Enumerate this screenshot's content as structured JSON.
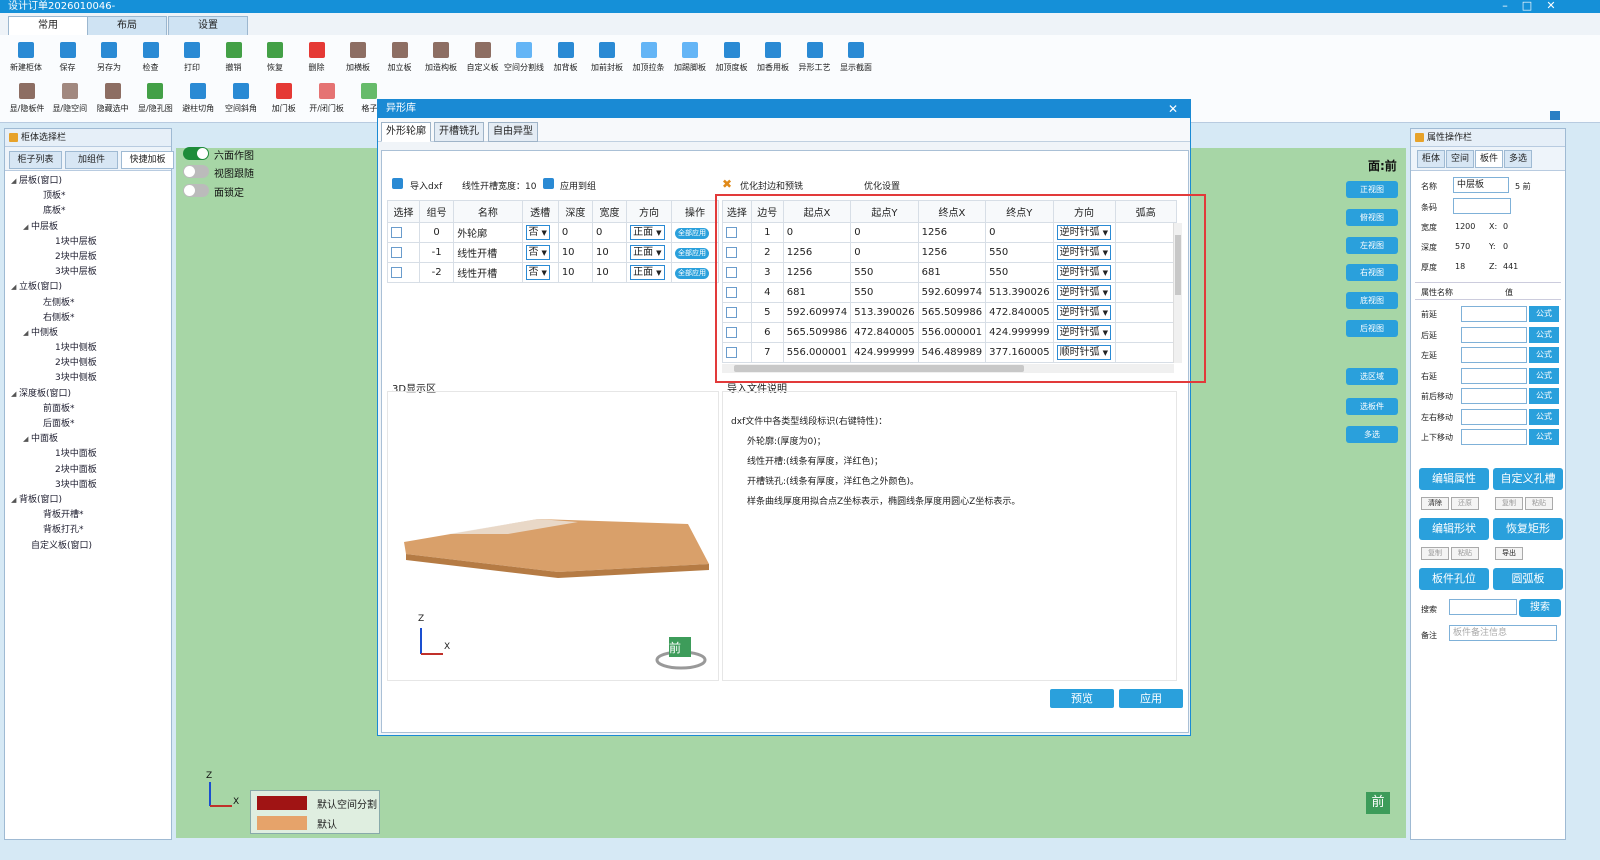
{
  "window": {
    "title": "设计订单2026010046-",
    "controls": [
      "–",
      "□",
      "✕"
    ]
  },
  "ribbon": {
    "tabs": [
      "常用",
      "布局",
      "设置"
    ],
    "row1": [
      "新建柜体",
      "保存",
      "另存为",
      "检查",
      "打印",
      "撤销",
      "恢复",
      "删除",
      "加横板",
      "加立板",
      "加造构板",
      "自定义板",
      "空间分割线",
      "加背板",
      "加前封板",
      "加顶拉条",
      "加踢脚板",
      "加顶度板",
      "加香用板",
      "异形工艺",
      "显示截面"
    ],
    "row2": [
      "显/隐板件",
      "显/隐空间",
      "隐藏选中",
      "显/隐孔图",
      "避柱切角",
      "空间斜角",
      "加门板",
      "开/闭门板",
      "格子"
    ]
  },
  "left_panel": {
    "title": "柜体选择栏",
    "tabs": [
      "柜子列表",
      "加组件",
      "快捷加板"
    ],
    "tree": [
      {
        "label": "层板(窗口)",
        "level": 0,
        "exp": true
      },
      {
        "label": "顶板*",
        "level": 2
      },
      {
        "label": "底板*",
        "level": 2
      },
      {
        "label": "中层板",
        "level": 1,
        "exp": true
      },
      {
        "label": "1块中层板",
        "level": 3
      },
      {
        "label": "2块中层板",
        "level": 3
      },
      {
        "label": "3块中层板",
        "level": 3
      },
      {
        "label": "立板(窗口)",
        "level": 0,
        "exp": true
      },
      {
        "label": "左侧板*",
        "level": 2
      },
      {
        "label": "右侧板*",
        "level": 2
      },
      {
        "label": "中侧板",
        "level": 1,
        "exp": true
      },
      {
        "label": "1块中侧板",
        "level": 3
      },
      {
        "label": "2块中侧板",
        "level": 3
      },
      {
        "label": "3块中侧板",
        "level": 3
      },
      {
        "label": "深度板(窗口)",
        "level": 0,
        "exp": true
      },
      {
        "label": "前面板*",
        "level": 2
      },
      {
        "label": "后面板*",
        "level": 2
      },
      {
        "label": "中面板",
        "level": 1,
        "exp": true
      },
      {
        "label": "1块中面板",
        "level": 3
      },
      {
        "label": "2块中面板",
        "level": 3
      },
      {
        "label": "3块中面板",
        "level": 3
      },
      {
        "label": "背板(窗口)",
        "level": 0,
        "exp": true
      },
      {
        "label": "背板开槽*",
        "level": 2
      },
      {
        "label": "背板打孔*",
        "level": 2
      },
      {
        "label": "自定义板(窗口)",
        "level": 1
      }
    ]
  },
  "canvas": {
    "toggles": [
      {
        "label": "六面作图",
        "on": true
      },
      {
        "label": "视图跟随",
        "on": false
      },
      {
        "label": "面锁定",
        "on": false
      }
    ],
    "face_label": "面:前",
    "view_buttons": [
      "正视图",
      "俯视图",
      "左视图",
      "右视图",
      "底视图",
      "后视图",
      "选区域",
      "选板件",
      "多选"
    ],
    "axis_z": "Z",
    "axis_x": "X",
    "legend": [
      {
        "label": "默认空间分割",
        "color": "#a01414"
      },
      {
        "label": "默认",
        "color": "#e6a36a"
      }
    ],
    "front_cube": "前"
  },
  "dialog": {
    "title": "异形库",
    "close": "✕",
    "tabs": [
      "外形轮廓",
      "开槽铣孔",
      "自由异型"
    ],
    "toolbar": {
      "import": "导入dxf",
      "width_label": "线性开槽宽度：10",
      "apply_group": "应用到组",
      "optimize": "优化封边和预铣",
      "opt_settings": "优化设置"
    },
    "left_table": {
      "headers": [
        "选择",
        "组号",
        "名称",
        "透槽",
        "深度",
        "宽度",
        "方向",
        "操作"
      ],
      "rows": [
        {
          "group": "0",
          "name": "外轮廓",
          "through": "否",
          "depth": "0",
          "width": "0",
          "dir": "正面",
          "op": "全部应用"
        },
        {
          "group": "-1",
          "name": "线性开槽",
          "through": "否",
          "depth": "10",
          "width": "10",
          "dir": "正面",
          "op": "全部应用"
        },
        {
          "group": "-2",
          "name": "线性开槽",
          "through": "否",
          "depth": "10",
          "width": "10",
          "dir": "正面",
          "op": "全部应用"
        }
      ]
    },
    "right_table": {
      "headers": [
        "选择",
        "边号",
        "起点X",
        "起点Y",
        "终点X",
        "终点Y",
        "方向",
        "弧高"
      ],
      "rows": [
        {
          "no": "1",
          "sx": "0",
          "sy": "0",
          "ex": "1256",
          "ey": "0",
          "dir": "逆时针弧",
          "arc": ""
        },
        {
          "no": "2",
          "sx": "1256",
          "sy": "0",
          "ex": "1256",
          "ey": "550",
          "dir": "逆时针弧",
          "arc": ""
        },
        {
          "no": "3",
          "sx": "1256",
          "sy": "550",
          "ex": "681",
          "ey": "550",
          "dir": "逆时针弧",
          "arc": ""
        },
        {
          "no": "4",
          "sx": "681",
          "sy": "550",
          "ex": "592.609974",
          "ey": "513.390026",
          "dir": "逆时针弧",
          "arc": ""
        },
        {
          "no": "5",
          "sx": "592.609974",
          "sy": "513.390026",
          "ex": "565.509986",
          "ey": "472.840005",
          "dir": "逆时针弧",
          "arc": ""
        },
        {
          "no": "6",
          "sx": "565.509986",
          "sy": "472.840005",
          "ex": "556.000001",
          "ey": "424.999999",
          "dir": "逆时针弧",
          "arc": ""
        },
        {
          "no": "7",
          "sx": "556.000001",
          "sy": "424.999999",
          "ex": "546.489989",
          "ey": "377.160005",
          "dir": "顺时针弧",
          "arc": ""
        }
      ]
    },
    "view3d_label": "3D显示区",
    "notes_title": "导入文件说明",
    "notes": [
      "dxf文件中各类型线段标识(右键特性)：",
      "外轮廓:(厚度为0)；",
      "线性开槽:(线条有厚度，洋红色)；",
      "开槽铣孔:(线条有厚度，洋红色之外颜色)。",
      "样条曲线厚度用拟合点Z坐标表示，椭圆线条厚度用圆心Z坐标表示。"
    ],
    "preview_btn": "预览",
    "apply_btn": "应用"
  },
  "right_panel": {
    "title": "属性操作栏",
    "tabs": [
      "柜体",
      "空间",
      "板件",
      "多选"
    ],
    "name_label": "名称",
    "name_value": "中层板",
    "name_suffix": "5  前",
    "barcode_label": "条码",
    "width_label": "宽度",
    "width_value": "1200",
    "x_label": "X:",
    "x_value": "0",
    "depth_label": "深度",
    "depth_value": "570",
    "y_label": "Y:",
    "y_value": "0",
    "thick_label": "厚度",
    "thick_value": "18",
    "z_label": "Z:",
    "z_value": "441",
    "attr_header": "属性名称",
    "val_header": "值",
    "attrs": [
      "前延",
      "后延",
      "左延",
      "右延",
      "前后移动",
      "左右移动",
      "上下移动"
    ],
    "formula": "公式",
    "buttons": [
      "编辑属性",
      "自定义孔槽",
      "编辑形状",
      "恢复矩形",
      "板件孔位",
      "圆弧板"
    ],
    "small1": [
      "清除",
      "还原",
      "复制",
      "粘贴"
    ],
    "small2": [
      "复制",
      "粘贴",
      "导出"
    ],
    "search_label": "搜索",
    "search_btn": "搜索",
    "note_label": "备注",
    "note_placeholder": "板件备注信息"
  }
}
